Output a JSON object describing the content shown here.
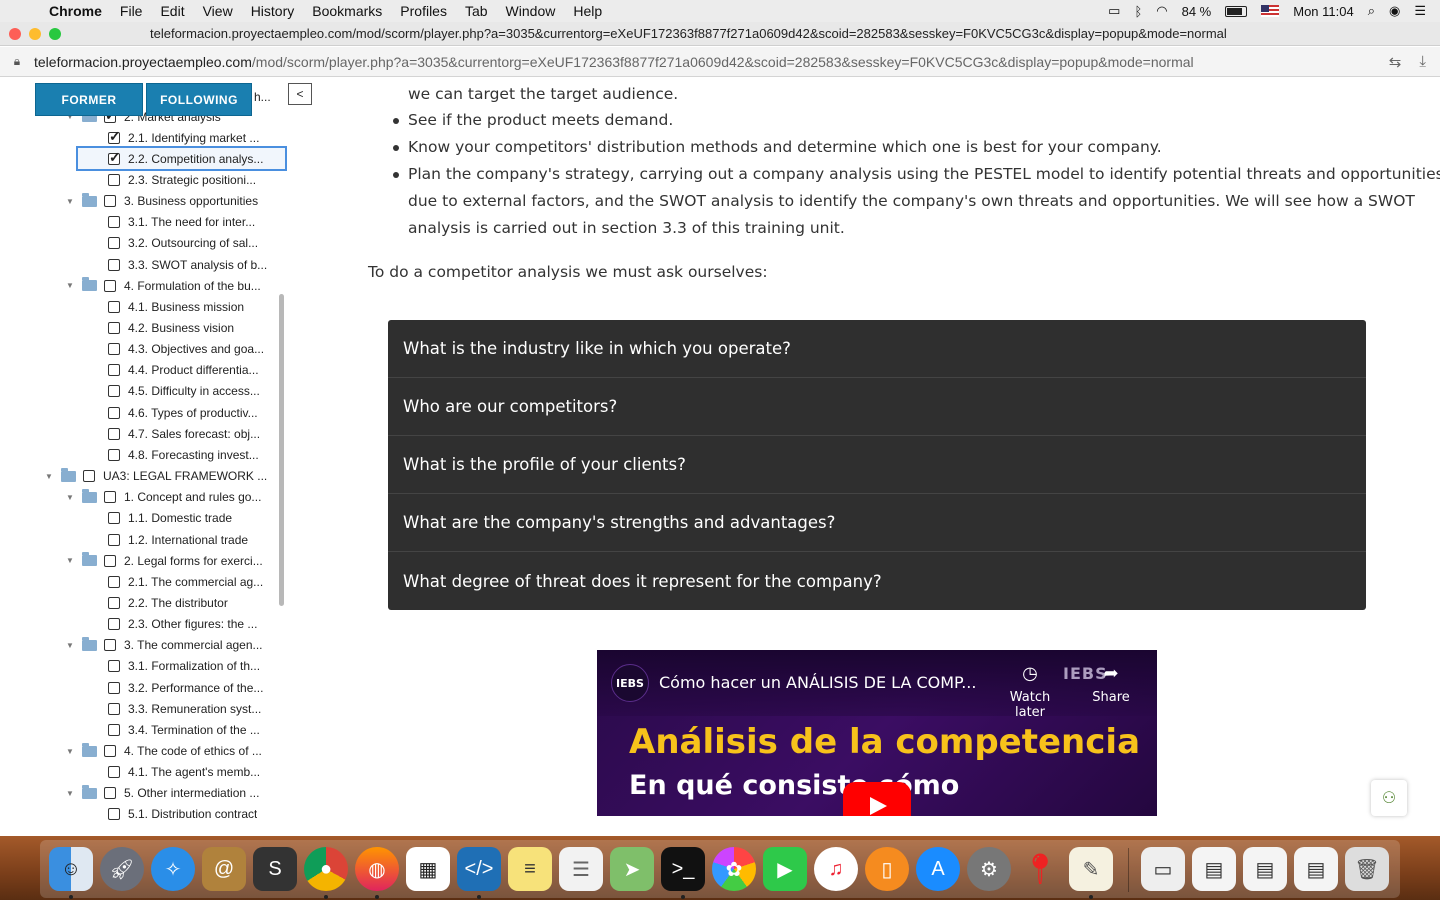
{
  "menubar": {
    "app": "Chrome",
    "items": [
      "File",
      "Edit",
      "View",
      "History",
      "Bookmarks",
      "Profiles",
      "Tab",
      "Window",
      "Help"
    ],
    "battery": "84 %",
    "clock": "Mon 11:04"
  },
  "window": {
    "title": "teleformacion.proyectaempleo.com/mod/scorm/player.php?a=3035&currentorg=eXeUF172363f8877f271a0609d42&scoid=282583&sesskey=F0KVC5CG3c&display=popup&mode=normal"
  },
  "address": {
    "host": "teleformacion.proyectaempleo.com",
    "path": "/mod/scorm/player.php?a=3035&currentorg=eXeUF172363f8877f271a0609d42&scoid=282583&sesskey=F0KVC5CG3c&display=popup&mode=normal"
  },
  "sidebar": {
    "former_label": "FORMER",
    "following_label": "FOLLOWING",
    "hidden_trunc": "h...",
    "collapse_label": "<",
    "tree": [
      {
        "label": "2. Market analysis",
        "level": 1,
        "folder": true,
        "checked": true
      },
      {
        "label": "2.1. Identifying market ...",
        "level": 2,
        "checked": true
      },
      {
        "label": "2.2. Competition analys...",
        "level": 2,
        "checked": true,
        "selected": true
      },
      {
        "label": "2.3. Strategic positioni...",
        "level": 2
      },
      {
        "label": "3. Business opportunities",
        "level": 1,
        "folder": true
      },
      {
        "label": "3.1. The need for inter...",
        "level": 2
      },
      {
        "label": "3.2. Outsourcing of sal...",
        "level": 2
      },
      {
        "label": "3.3. SWOT analysis of b...",
        "level": 2
      },
      {
        "label": "4. Formulation of the bu...",
        "level": 1,
        "folder": true
      },
      {
        "label": "4.1. Business mission",
        "level": 2
      },
      {
        "label": "4.2. Business vision",
        "level": 2
      },
      {
        "label": "4.3. Objectives and goa...",
        "level": 2
      },
      {
        "label": "4.4. Product differentia...",
        "level": 2
      },
      {
        "label": "4.5. Difficulty in access...",
        "level": 2
      },
      {
        "label": "4.6. Types of productiv...",
        "level": 2
      },
      {
        "label": "4.7. Sales forecast: obj...",
        "level": 2
      },
      {
        "label": "4.8. Forecasting invest...",
        "level": 2
      },
      {
        "label": "UA3: LEGAL FRAMEWORK ...",
        "level": 0,
        "folder": true
      },
      {
        "label": "1. Concept and rules go...",
        "level": 1,
        "folder": true
      },
      {
        "label": "1.1. Domestic trade",
        "level": 2
      },
      {
        "label": "1.2. International trade",
        "level": 2
      },
      {
        "label": "2. Legal forms for exerci...",
        "level": 1,
        "folder": true
      },
      {
        "label": "2.1. The commercial ag...",
        "level": 2
      },
      {
        "label": "2.2. The distributor",
        "level": 2
      },
      {
        "label": "2.3. Other figures: the ...",
        "level": 2
      },
      {
        "label": "3. The commercial agen...",
        "level": 1,
        "folder": true
      },
      {
        "label": "3.1. Formalization of th...",
        "level": 2
      },
      {
        "label": "3.2. Performance of the...",
        "level": 2
      },
      {
        "label": "3.3. Remuneration syst...",
        "level": 2
      },
      {
        "label": "3.4. Termination of the ...",
        "level": 2
      },
      {
        "label": "4. The code of ethics of ...",
        "level": 1,
        "folder": true
      },
      {
        "label": "4.1. The agent's memb...",
        "level": 2
      },
      {
        "label": "5. Other intermediation ...",
        "level": 1,
        "folder": true
      },
      {
        "label": "5.1. Distribution contract",
        "level": 2
      }
    ]
  },
  "content": {
    "line_top": "we can target the target audience.",
    "bullets": [
      "See if the product meets demand.",
      "Know your competitors' distribution methods and determine which one is best for your company."
    ],
    "strategy_lines": [
      "Plan the company's strategy, carrying out a company analysis using the PESTEL model to identify potential threats and opportunities",
      "due to external factors, and the SWOT analysis to identify the company's own threats and opportunities. We will see how a SWOT",
      "analysis is carried out in section 3.3 of this training unit."
    ],
    "intro": "To do a competitor analysis we must ask ourselves:",
    "questions": [
      "What is the industry like in which you operate?",
      "Who are our competitors?",
      "What is the profile of your clients?",
      "What are the company's strengths and advantages?",
      "What degree of threat does it represent for the company?"
    ]
  },
  "video": {
    "channel_logo": "IEBS",
    "title": "Cómo hacer un ANÁLISIS DE LA COMP...",
    "watch_later": "Watch later",
    "share": "Share",
    "brand": "IEBS",
    "headline": "Análisis de la competencia",
    "subline": "En qué consiste cómo"
  },
  "colors": {
    "nav_button": "#1a7fb0",
    "accordion_bg": "#2f2f2f",
    "video_headline": "#f7c21b"
  }
}
